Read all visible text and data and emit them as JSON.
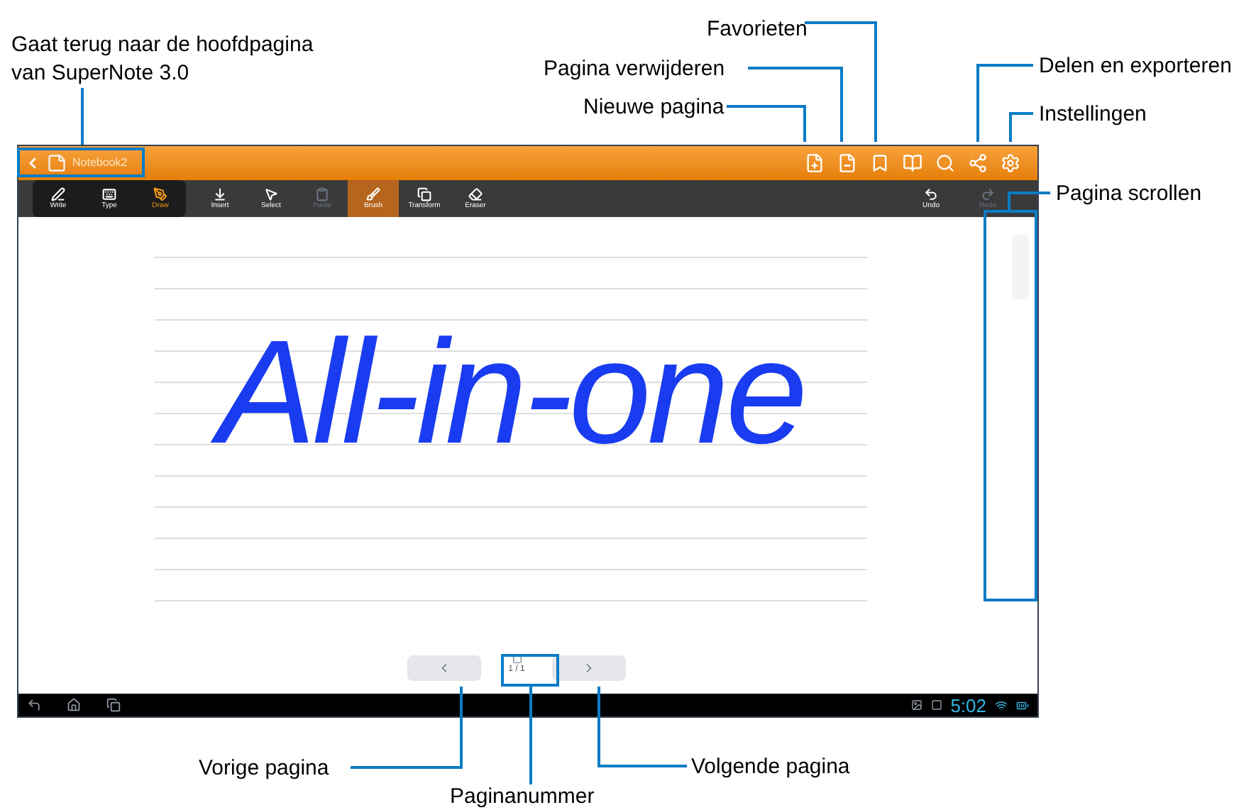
{
  "callouts": [
    {
      "text": "Gaat terug naar de hoofdpagina van SuperNote 3.0"
    },
    {
      "text": "Favorieten"
    },
    {
      "text": "Pagina verwijderen"
    },
    {
      "text": "Nieuwe pagina"
    },
    {
      "text": "Delen en exporteren"
    },
    {
      "text": "Instellingen"
    },
    {
      "text": "Pagina scrollen"
    },
    {
      "text": "Vorige pagina"
    },
    {
      "text": "Paginanummer"
    },
    {
      "text": "Volgende pagina"
    }
  ],
  "title_bar": {
    "notebook": "Notebook2"
  },
  "mode_tools": [
    {
      "label": "Write",
      "kind": "write",
      "selected": false
    },
    {
      "label": "Type",
      "kind": "type",
      "selected": false
    },
    {
      "label": "Draw",
      "kind": "draw",
      "selected": true
    }
  ],
  "tools": [
    {
      "label": "Insert",
      "kind": "insert",
      "selected": false,
      "disabled": false
    },
    {
      "label": "Select",
      "kind": "select",
      "selected": false,
      "disabled": false
    },
    {
      "label": "Paste",
      "kind": "paste",
      "selected": false,
      "disabled": true
    },
    {
      "label": "Brush",
      "kind": "brush",
      "selected": true,
      "disabled": false
    },
    {
      "label": "Transform",
      "kind": "transform",
      "selected": false,
      "disabled": false
    },
    {
      "label": "Eraser",
      "kind": "eraser",
      "selected": false,
      "disabled": false
    }
  ],
  "history": [
    {
      "label": "Undo",
      "kind": "undo",
      "disabled": false
    },
    {
      "label": "Redo",
      "kind": "redo",
      "disabled": true
    }
  ],
  "handwriting": "All-in-one",
  "page_nav": {
    "page_indicator": "1 / 1"
  },
  "status_bar": {
    "time": "5:02"
  }
}
